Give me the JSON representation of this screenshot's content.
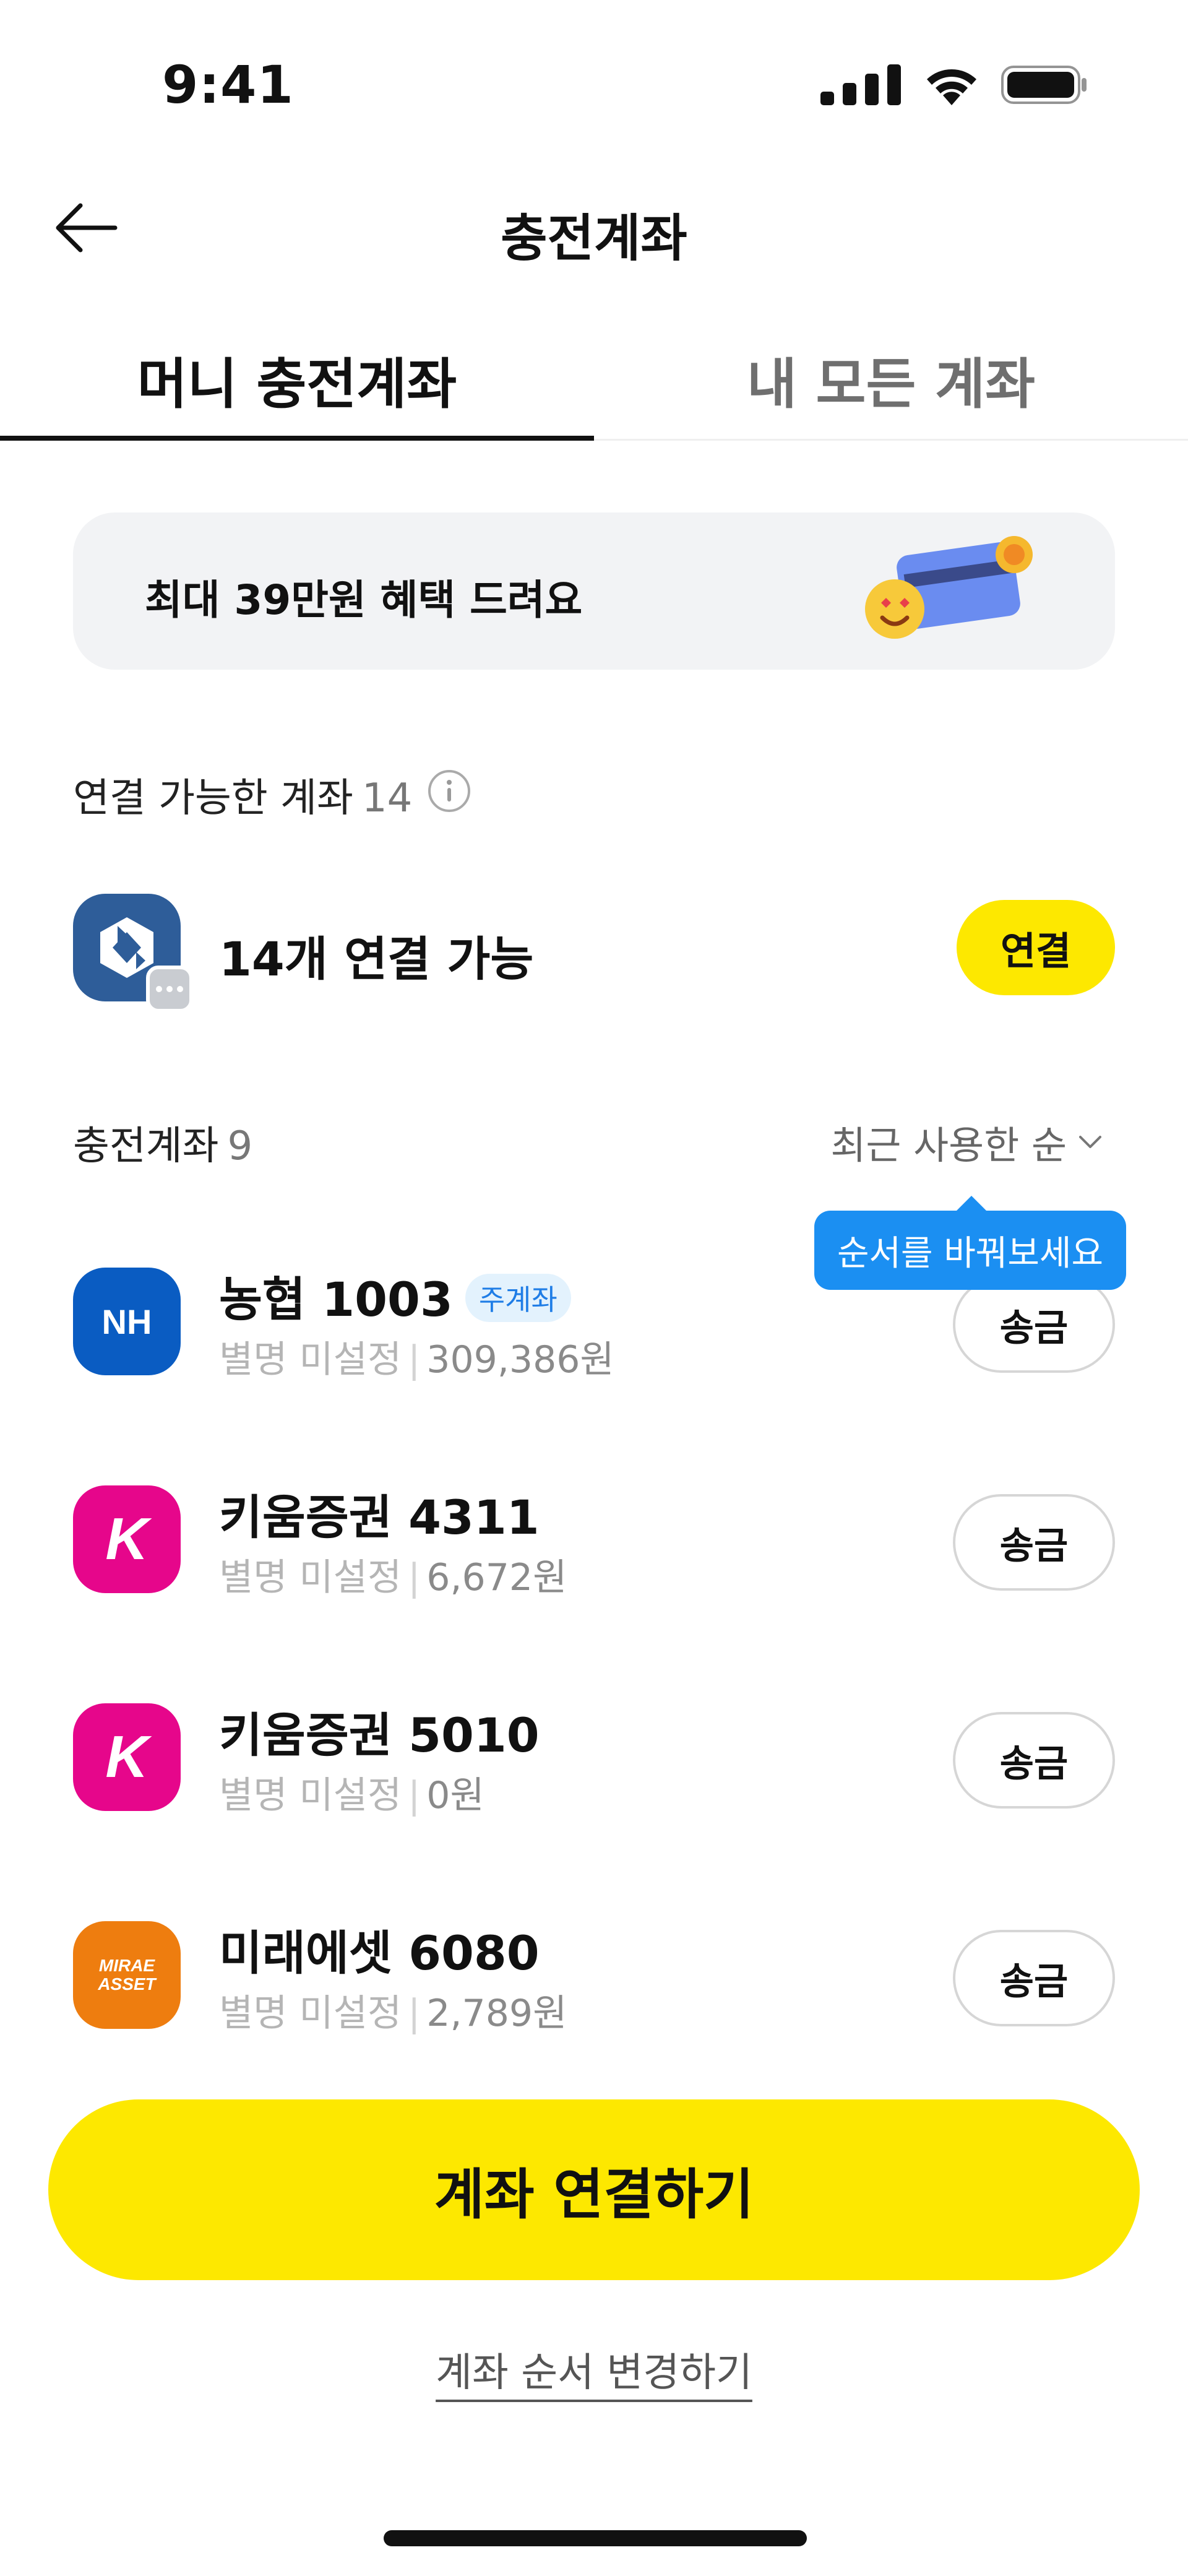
{
  "status_bar": {
    "time": "9:41"
  },
  "header": {
    "title": "충전계좌"
  },
  "tabs": [
    {
      "label": "머니 충전계좌",
      "active": true
    },
    {
      "label": "내 모든 계좌",
      "active": false
    }
  ],
  "promo": {
    "text": "최대 39만원 혜택 드려요"
  },
  "connectable": {
    "label": "연결 가능한 계좌",
    "count": "14",
    "summary": "14개 연결 가능",
    "button": "연결"
  },
  "charge_accounts": {
    "label": "충전계좌",
    "count": "9",
    "sort_label": "최근 사용한 순",
    "tooltip": "순서를 바꿔보세요",
    "items": [
      {
        "name": "농협 1003",
        "badge": "주계좌",
        "alias": "별명 미설정",
        "balance": "309,386원",
        "logo_text": "NH",
        "button": "송금"
      },
      {
        "name": "키움증권 4311",
        "alias": "별명 미설정",
        "balance": "6,672원",
        "logo_text": "K",
        "button": "송금"
      },
      {
        "name": "키움증권 5010",
        "alias": "별명 미설정",
        "balance": "0원",
        "logo_text": "K",
        "button": "송금"
      },
      {
        "name": "미래에셋 6080",
        "alias": "별명 미설정",
        "balance": "2,789원",
        "logo_text": "MIRAE ASSET",
        "button": "송금"
      }
    ]
  },
  "bottom": {
    "cta": "계좌 연결하기",
    "reorder_link": "계좌 순서 변경하기"
  },
  "colors": {
    "accent_yellow": "#fde800",
    "tooltip_blue": "#1b8ff2",
    "nh_blue": "#0a5cc2",
    "kiwoom_pink": "#e6068b",
    "mirae_orange": "#ee7d0f",
    "connect_logo_blue": "#2e5d99"
  }
}
